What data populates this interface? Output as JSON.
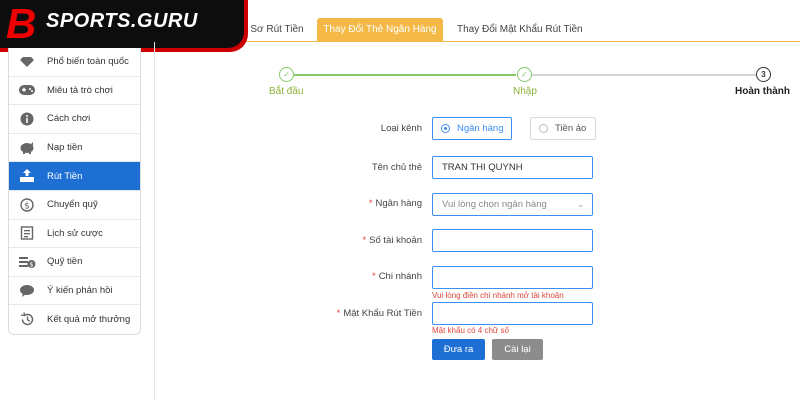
{
  "brand": {
    "logo_text": "SPORTS.GURU",
    "logo_letter": "B"
  },
  "top_tabs": [
    {
      "label": "ồ Sơ Rút Tiền",
      "active": false
    },
    {
      "label": "Thay Đổi Thẻ Ngân Hàng",
      "active": true
    },
    {
      "label": "Thay Đổi Mật Khẩu Rút Tiền",
      "active": false
    }
  ],
  "sidebar": {
    "items": [
      {
        "label": "Phổ biến toàn quốc",
        "icon": "diamond-icon"
      },
      {
        "label": "Miêu tả trò chơi",
        "icon": "gamepad-icon"
      },
      {
        "label": "Cách chơi",
        "icon": "info-icon"
      },
      {
        "label": "Nạp tiền",
        "icon": "piggy-bank-icon"
      },
      {
        "label": "Rút Tiền",
        "icon": "withdraw-icon",
        "active": true
      },
      {
        "label": "Chuyển quỹ",
        "icon": "dollar-circle-icon"
      },
      {
        "label": "Lịch sử cược",
        "icon": "history-list-icon"
      },
      {
        "label": "Quỹ tiền",
        "icon": "fund-icon"
      },
      {
        "label": "Ý kiến phản hồi",
        "icon": "chat-bubble-icon"
      },
      {
        "label": "Kết quả mở thưởng",
        "icon": "clock-history-icon"
      }
    ]
  },
  "steps": [
    {
      "label": "Bắt đầu",
      "status": "done",
      "marker": "✓"
    },
    {
      "label": "Nhập",
      "status": "done",
      "marker": "✓"
    },
    {
      "label": "Hoàn thành",
      "status": "current",
      "marker": "3"
    }
  ],
  "form": {
    "channel": {
      "label": "Loại kênh",
      "options": [
        "Ngân hàng",
        "Tiền ảo"
      ],
      "selected": "Ngân hàng"
    },
    "holder": {
      "label": "Tên chủ thẻ",
      "value": "TRAN THI QUYNH"
    },
    "bank": {
      "label": "Ngân hàng",
      "required": "*",
      "placeholder": "Vui lòng chọn ngân hàng"
    },
    "account": {
      "label": "Số tài khoản",
      "required": "*",
      "value": ""
    },
    "branch": {
      "label": "Chi nhánh",
      "required": "*",
      "value": "",
      "hint": "Vui lòng điền chi nhánh mở tài khoản"
    },
    "password": {
      "label": "Mật Khẩu Rút Tiền",
      "required": "*",
      "value": "",
      "hint": "Mật khẩu có 4 chữ số"
    },
    "submit_label": "Đưa ra",
    "reset_label": "Cài lại"
  },
  "colors": {
    "accent": "#1e6fd3",
    "tab_active": "#f4b847",
    "success": "#86c86a",
    "error": "#e0453a"
  }
}
